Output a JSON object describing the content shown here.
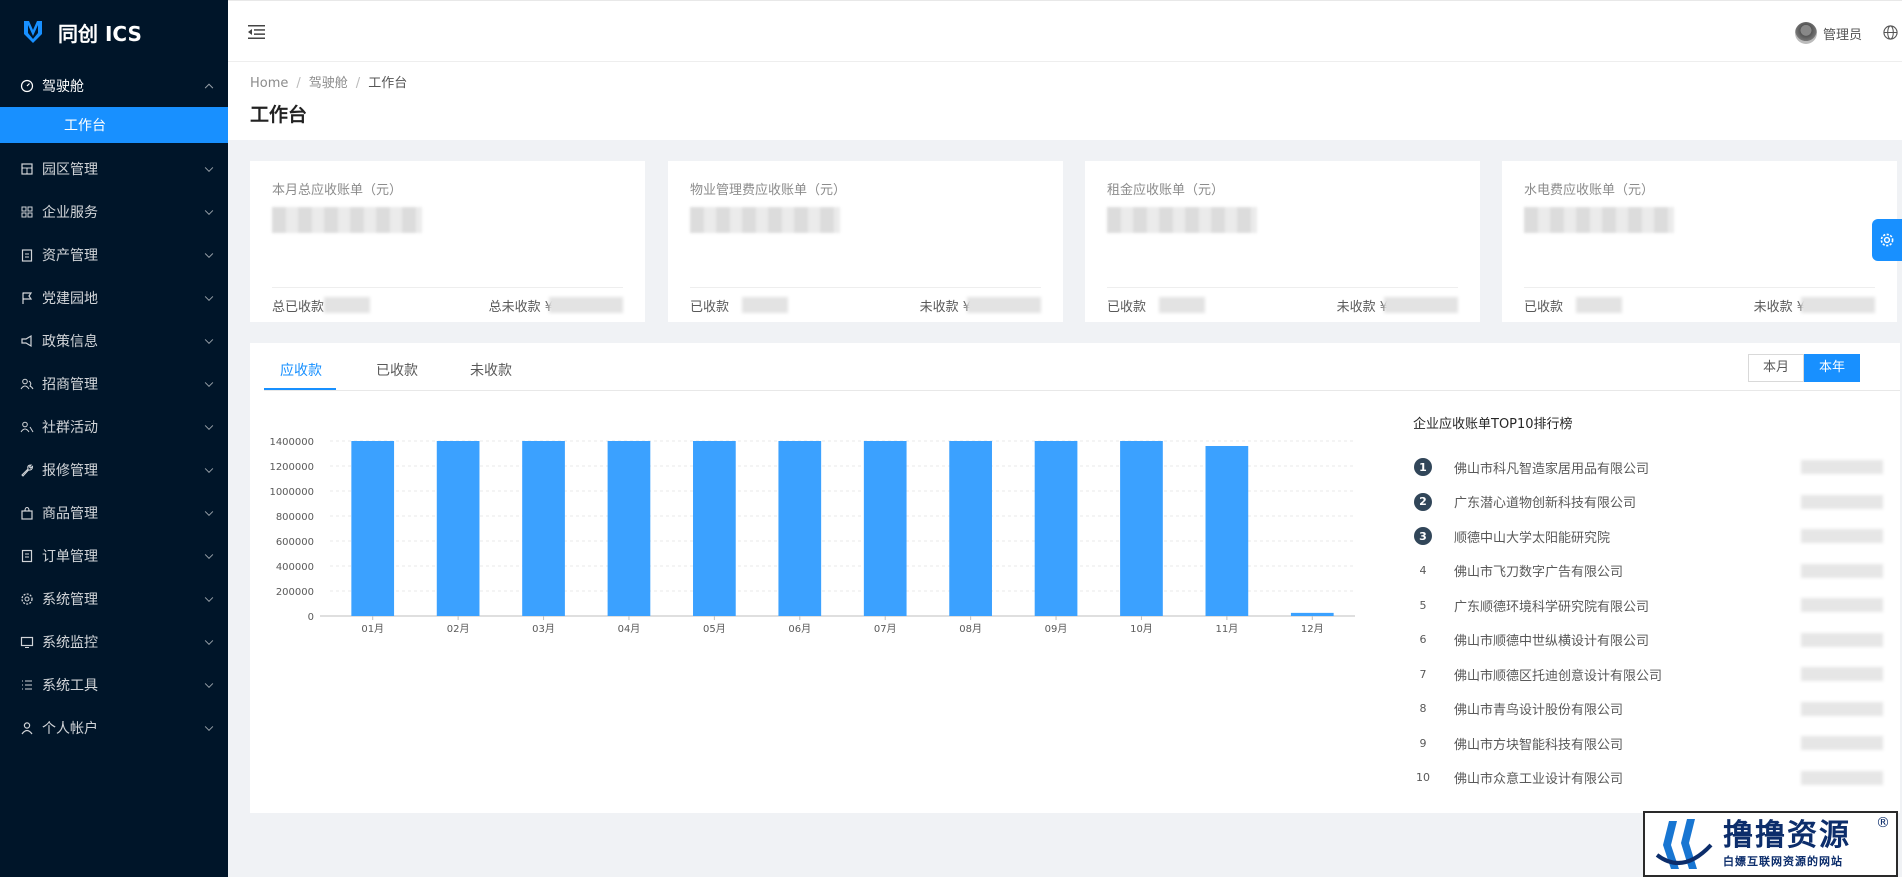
{
  "app": {
    "name": "同创 ICS"
  },
  "sidebar": {
    "items": [
      {
        "label": "驾驶舱",
        "icon": "dashboard-icon",
        "open": true,
        "children": [
          {
            "label": "工作台",
            "active": true
          }
        ]
      },
      {
        "label": "园区管理",
        "icon": "building-icon"
      },
      {
        "label": "企业服务",
        "icon": "grid-icon"
      },
      {
        "label": "资产管理",
        "icon": "clipboard-icon"
      },
      {
        "label": "党建园地",
        "icon": "flag-icon"
      },
      {
        "label": "政策信息",
        "icon": "megaphone-icon"
      },
      {
        "label": "招商管理",
        "icon": "users-icon"
      },
      {
        "label": "社群活动",
        "icon": "team-icon"
      },
      {
        "label": "报修管理",
        "icon": "wrench-icon"
      },
      {
        "label": "商品管理",
        "icon": "bag-icon"
      },
      {
        "label": "订单管理",
        "icon": "document-icon"
      },
      {
        "label": "系统管理",
        "icon": "gear-icon"
      },
      {
        "label": "系统监控",
        "icon": "monitor-icon"
      },
      {
        "label": "系统工具",
        "icon": "list-icon"
      },
      {
        "label": "个人帐户",
        "icon": "user-icon"
      }
    ]
  },
  "header": {
    "user_name": "管理员"
  },
  "breadcrumb": [
    "Home",
    "驾驶舱",
    "工作台"
  ],
  "page_title": "工作台",
  "cards": [
    {
      "title": "本月总应收账单（元）",
      "left_label": "总已收款",
      "right_label": "总未收款 ¥"
    },
    {
      "title": "物业管理费应收账单（元）",
      "left_label": "已收款",
      "right_label": "未收款 ¥"
    },
    {
      "title": "租金应收账单（元）",
      "left_label": "已收款",
      "right_label": "未收款 ¥"
    },
    {
      "title": "水电费应收账单（元）",
      "left_label": "已收款",
      "right_label": "未收款 ¥"
    }
  ],
  "tabs": [
    "应收款",
    "已收款",
    "未收款"
  ],
  "active_tab": 0,
  "period_buttons": [
    "本月",
    "本年"
  ],
  "active_period": 1,
  "chart_data": {
    "type": "bar",
    "categories": [
      "01月",
      "02月",
      "03月",
      "04月",
      "05月",
      "06月",
      "07月",
      "08月",
      "09月",
      "10月",
      "11月",
      "12月"
    ],
    "values": [
      1400000,
      1400000,
      1400000,
      1400000,
      1400000,
      1400000,
      1400000,
      1400000,
      1400000,
      1400000,
      1360000,
      25000
    ],
    "yticks": [
      0,
      200000,
      400000,
      600000,
      800000,
      1000000,
      1200000,
      1400000
    ],
    "ylim": [
      0,
      1400000
    ],
    "grid": true,
    "bar_color": "#3ba1ff"
  },
  "ranking": {
    "title": "企业应收账单TOP10排行榜",
    "items": [
      {
        "rank": "1",
        "name": "佛山市科凡智造家居用品有限公司"
      },
      {
        "rank": "2",
        "name": "广东潜心道物创新科技有限公司"
      },
      {
        "rank": "3",
        "name": "顺德中山大学太阳能研究院"
      },
      {
        "rank": "4",
        "name": "佛山市飞刀数字广告有限公司"
      },
      {
        "rank": "5",
        "name": "广东顺德环境科学研究院有限公司"
      },
      {
        "rank": "6",
        "name": "佛山市顺德中世纵横设计有限公司"
      },
      {
        "rank": "7",
        "name": "佛山市顺德区托迪创意设计有限公司"
      },
      {
        "rank": "8",
        "name": "佛山市青鸟设计股份有限公司"
      },
      {
        "rank": "9",
        "name": "佛山市方块智能科技有限公司"
      },
      {
        "rank": "10",
        "name": "佛山市众意工业设计有限公司"
      }
    ]
  },
  "watermark": {
    "title": "撸撸资源",
    "subtitle": "白嫖互联网资源的网站",
    "reg": "®"
  },
  "colors": {
    "sidebar_bg": "#001529",
    "accent": "#1890ff"
  }
}
